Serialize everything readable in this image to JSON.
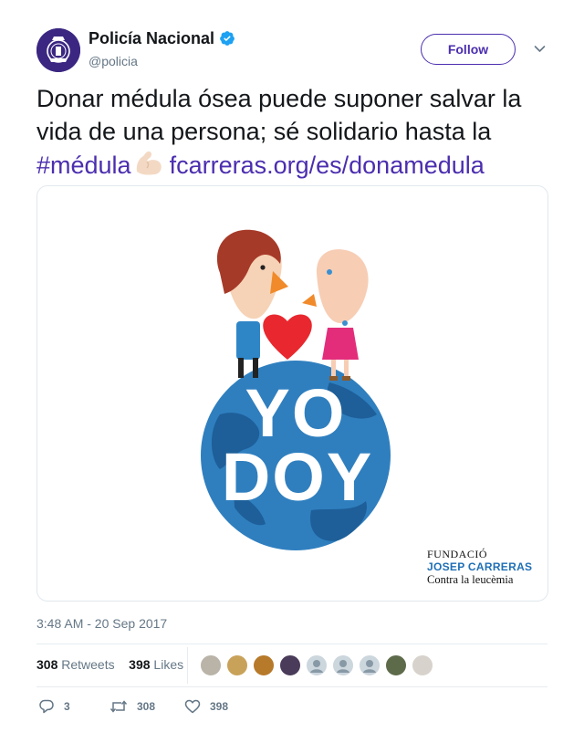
{
  "author": {
    "name": "Policía Nacional",
    "handle": "@policia",
    "verified_color": "#1da1f2"
  },
  "follow_label": "Follow",
  "tweet": {
    "line1": "Donar médula ósea puede suponer salvar la",
    "line2": "vida de una persona; sé solidario hasta la",
    "hashtag": "#médula",
    "emoji": "flexed-biceps-emoji",
    "link": "fcarreras.org/es/donamedula",
    "link_color": "#4b2eaf"
  },
  "media": {
    "headline_line1": "YO",
    "headline_line2": "DOY",
    "org_line1": "FUNDACIÓ",
    "org_line2": "JOSEP CARRERAS",
    "org_line3": "Contra la leucèmia"
  },
  "timestamp": "3:48 AM - 20 Sep 2017",
  "stats": {
    "retweets_count": "308",
    "retweets_label": "Retweets",
    "likes_count": "398",
    "likes_label": "Likes"
  },
  "actions": {
    "reply_count": "3",
    "retweet_count": "308",
    "like_count": "398"
  }
}
